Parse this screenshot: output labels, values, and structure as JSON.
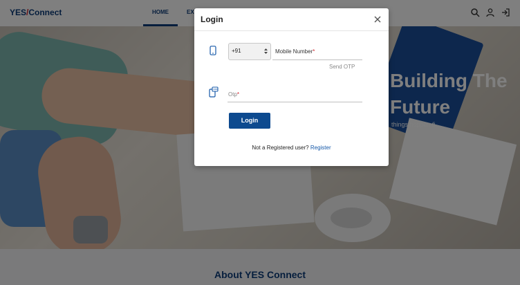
{
  "navbar": {
    "logo_part1": "YES",
    "logo_slash": "/",
    "logo_part2": "Connect",
    "home_label": "HOME",
    "partial_nav_label": "EX",
    "icons": [
      "search-icon",
      "user-icon",
      "logout-icon"
    ]
  },
  "hero": {
    "title": "Building The\nFuture",
    "subtitle": "things happen fi"
  },
  "about": {
    "title": "About YES Connect"
  },
  "modal": {
    "title": "Login",
    "close_icon": "close-icon",
    "country_code": "+91",
    "mobile_label": "Mobile Number",
    "required_mark": "*",
    "send_otp_label": "Send OTP",
    "otp_label": "Otp",
    "login_button": "Login",
    "register_prompt": "Not a Registered user?",
    "register_link": "Register"
  },
  "colors": {
    "brand_blue": "#0d3c7a",
    "button_blue": "#0d4a8f",
    "link_blue": "#1558a8",
    "required_red": "#d0202a"
  }
}
